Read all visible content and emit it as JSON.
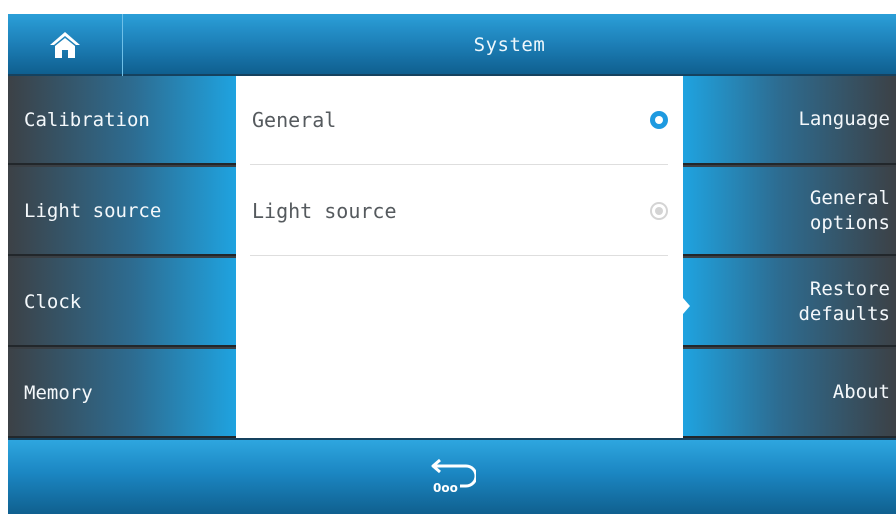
{
  "header": {
    "home_icon": "home-icon",
    "title": "System"
  },
  "left_menu": [
    {
      "label": "Calibration"
    },
    {
      "label": "Light source"
    },
    {
      "label": "Clock"
    },
    {
      "label": "Memory"
    }
  ],
  "center_list": [
    {
      "label": "General",
      "selected": true
    },
    {
      "label": "Light source",
      "selected": false
    }
  ],
  "right_menu": [
    {
      "label": "Language"
    },
    {
      "label": "General\noptions"
    },
    {
      "label": "Restore\ndefaults"
    },
    {
      "label": "About"
    }
  ],
  "footer": {
    "back_icon": "back-to-zero-icon",
    "back_icon_text": "0oo"
  },
  "colors": {
    "accent": "#1e9ae0",
    "dark": "#3a3f44",
    "radio_off": "#d4d4d4"
  }
}
